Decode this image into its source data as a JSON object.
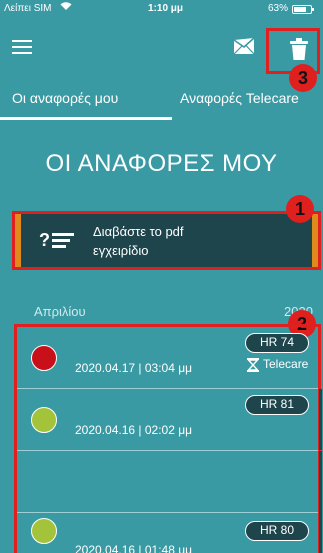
{
  "status_bar": {
    "carrier": "Λείπει SIM",
    "time": "1:10 μμ",
    "battery": "63%"
  },
  "toolbar": {
    "menu_icon": "hamburger-menu-icon",
    "mail_icon": "mail-envelope-icon",
    "trash_icon": "trash-icon"
  },
  "annotations": {
    "marker_1": "1",
    "marker_2": "2",
    "marker_3": "3",
    "highlight_color": "#e0201f"
  },
  "tabs": [
    {
      "label": "Οι αναφορές μου",
      "active": true
    },
    {
      "label": "Αναφορές Telecare",
      "active": false
    }
  ],
  "title": "ΟΙ ΑΝΑΦΟΡΕΣ ΜΟΥ",
  "manual": {
    "line1": "Διαβάστε το pdf",
    "line2": "εγχειρίδιο",
    "icon": "help-list-icon"
  },
  "month_header": {
    "month": "Απριλίου",
    "year": "2020"
  },
  "reports": [
    {
      "status_color": "#c8101a",
      "date": "2020.04.17 | 03:04 μμ",
      "hr": "HR 74",
      "telecare": "Telecare"
    },
    {
      "status_color": "#a3c43a",
      "date": "2020.04.16 | 02:02 μμ",
      "hr": "HR 81",
      "telecare": ""
    },
    {
      "status_color": "#a3c43a",
      "date": "2020.04.16 | 01:48 μμ",
      "hr": "HR 80",
      "telecare": ""
    }
  ],
  "colors": {
    "background": "#3a9aa4",
    "card_dark": "#1f454c",
    "accent_orange": "#e08a1e"
  }
}
